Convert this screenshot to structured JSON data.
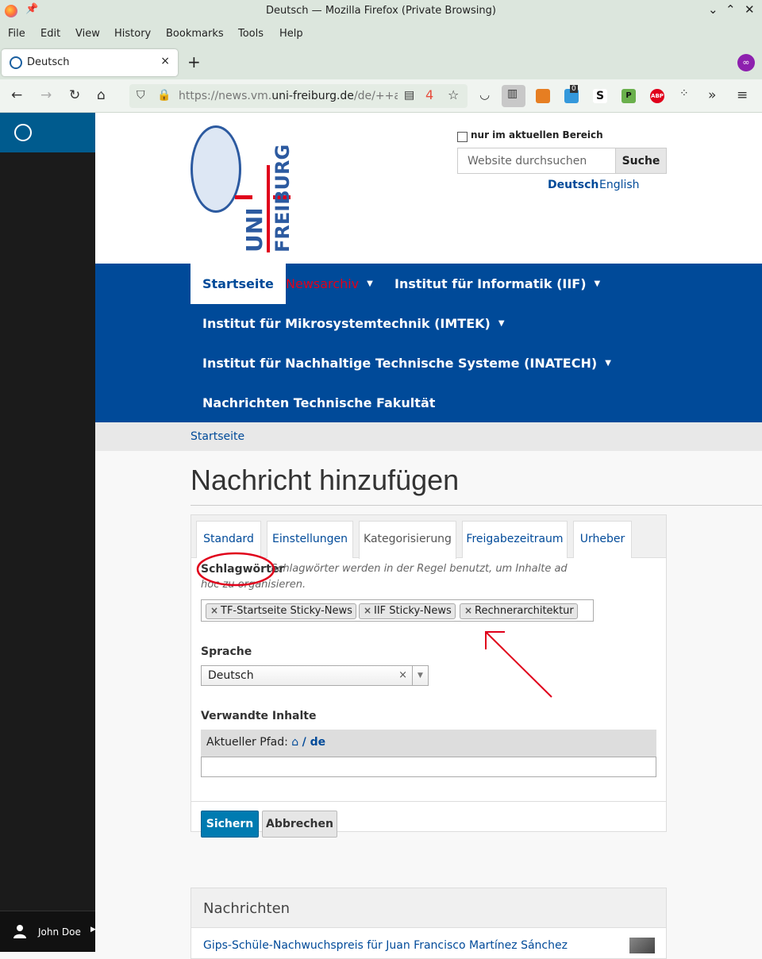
{
  "window": {
    "title": "Deutsch — Mozilla Firefox (Private Browsing)"
  },
  "menu": [
    "File",
    "Edit",
    "View",
    "History",
    "Bookmarks",
    "Tools",
    "Help"
  ],
  "tab": {
    "label": "Deutsch",
    "close": "×",
    "new": "+"
  },
  "urlbar": {
    "prefix": "https://news.vm.",
    "domain": "uni-freiburg.de",
    "suffix": "/de/++add++",
    "badge": "4"
  },
  "extensions": {
    "badge_count": "0",
    "abp": "ABP"
  },
  "sidebar": {
    "user": "John Doe"
  },
  "header": {
    "checkbox_label": "nur im aktuellen Bereich",
    "search_placeholder": "Website durchsuchen",
    "search_button": "Suche",
    "lang_de": "Deutsch",
    "lang_en": "English",
    "logo_uni": "UNI",
    "logo_freiburg": "FREIBURG"
  },
  "nav": {
    "home": "Startseite",
    "archive": "Newsarchiv",
    "iif": "Institut für Informatik (IIF)",
    "imtek": "Institut für Mikrosystemtechnik (IMTEK)",
    "inatech": "Institut für Nachhaltige Technische Systeme (INATECH)",
    "news_tf": "Nachrichten Technische Fakultät"
  },
  "breadcrumb": "Startseite",
  "page": {
    "title": "Nachricht hinzufügen"
  },
  "tabs": [
    "Standard",
    "Einstellungen",
    "Kategorisierung",
    "Freigabezeitraum",
    "Urheber"
  ],
  "form": {
    "tags_label": "Schlagwörter",
    "tags_help": "Schlagwörter werden in der Regel benutzt, um Inhalte ad hoc zu organisieren.",
    "tags": [
      "TF-Startseite Sticky-News",
      "IIF Sticky-News",
      "Rechnerarchitektur"
    ],
    "language_label": "Sprache",
    "language_value": "Deutsch",
    "related_label": "Verwandte Inhalte",
    "path_label": "Aktueller Pfad:",
    "path_value": "/ de",
    "save": "Sichern",
    "cancel": "Abbrechen"
  },
  "news": {
    "heading": "Nachrichten",
    "item": "Gips-Schüle-Nachwuchspreis für Juan Francisco Martínez Sánchez"
  },
  "colors": {
    "brand_blue": "#004a99",
    "annotation_red": "#e0001b",
    "sidebar_blue": "#005b8e"
  }
}
